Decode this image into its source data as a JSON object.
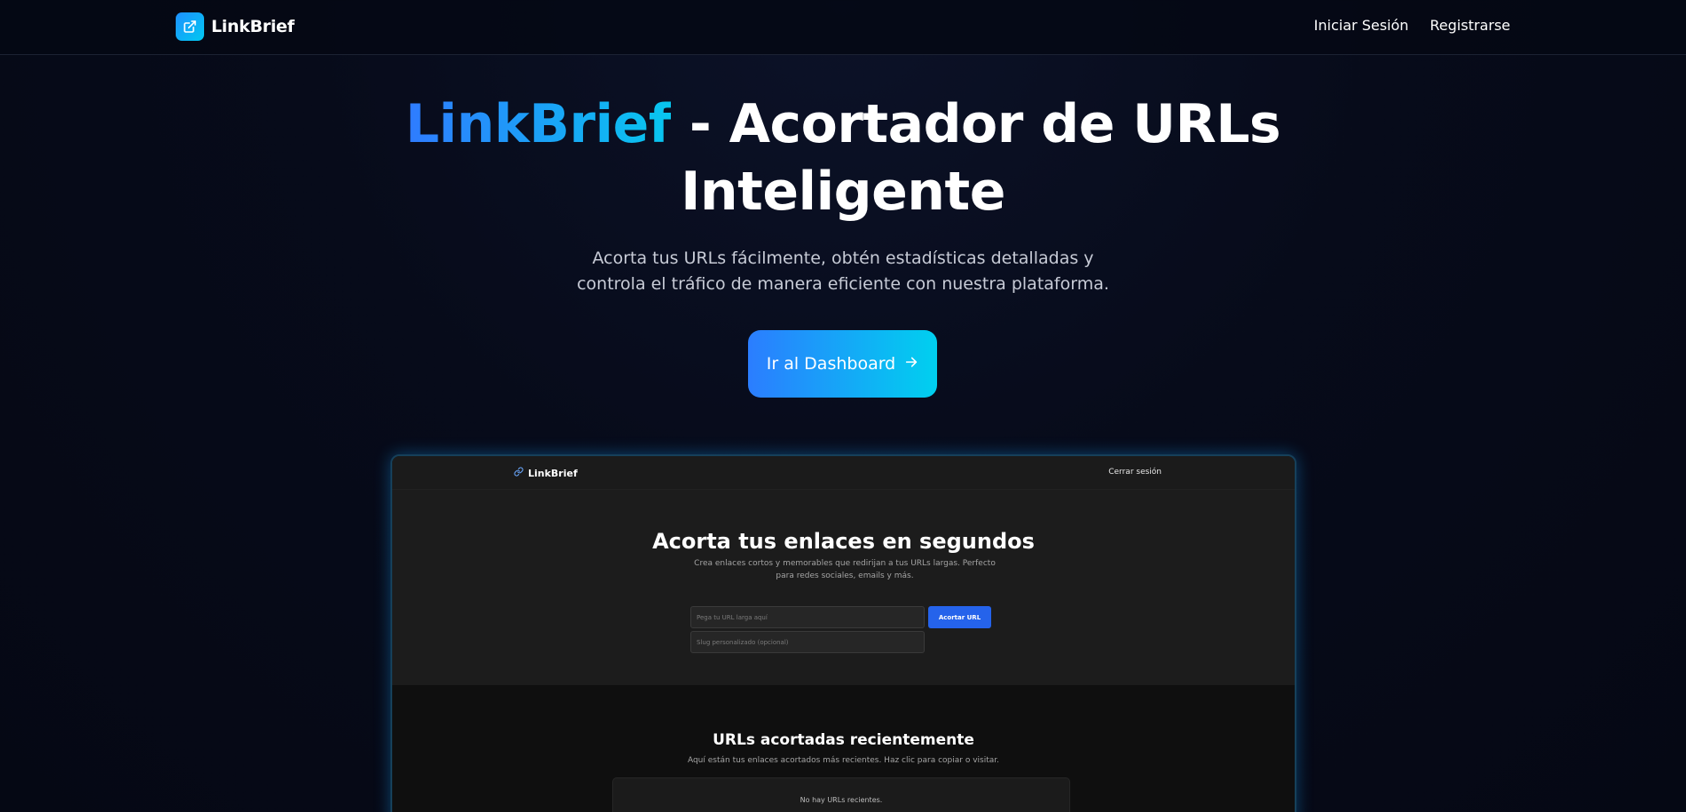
{
  "header": {
    "brand_name": "LinkBrief",
    "brand_icon": "external-link-icon",
    "nav": {
      "login_label": "Iniciar Sesión",
      "register_label": "Registrarse"
    }
  },
  "hero": {
    "title_brand": "LinkBrief",
    "title_rest_line1": " - Acortador de URLs",
    "title_line2": "Inteligente",
    "subtitle": "Acorta tus URLs fácilmente, obtén estadísticas detalladas y controla el tráfico de manera eficiente con nuestra plataforma.",
    "cta_label": "Ir al Dashboard",
    "cta_icon": "arrow-right-icon"
  },
  "preview": {
    "brand_name": "LinkBrief",
    "brand_icon": "link-icon",
    "logout_label": "Cerrar sesión",
    "title": "Acorta tus enlaces en segundos",
    "description": "Crea enlaces cortos y memorables que redirijan a tus URLs largas. Perfecto para redes sociales, emails y más.",
    "url_placeholder": "Pega tu URL larga aquí",
    "slug_placeholder": "Slug personalizado (opcional)",
    "shorten_label": "Acortar URL",
    "recent": {
      "title": "URLs acortadas recientemente",
      "subtitle": "Aquí están tus enlaces acortados más recientes. Haz clic para copiar o visitar.",
      "empty_text": "No hay URLs recientes."
    }
  },
  "colors": {
    "background": "#050814",
    "accent_start": "#2b7dff",
    "accent_end": "#00d0ef",
    "preview_button": "#2563eb"
  }
}
